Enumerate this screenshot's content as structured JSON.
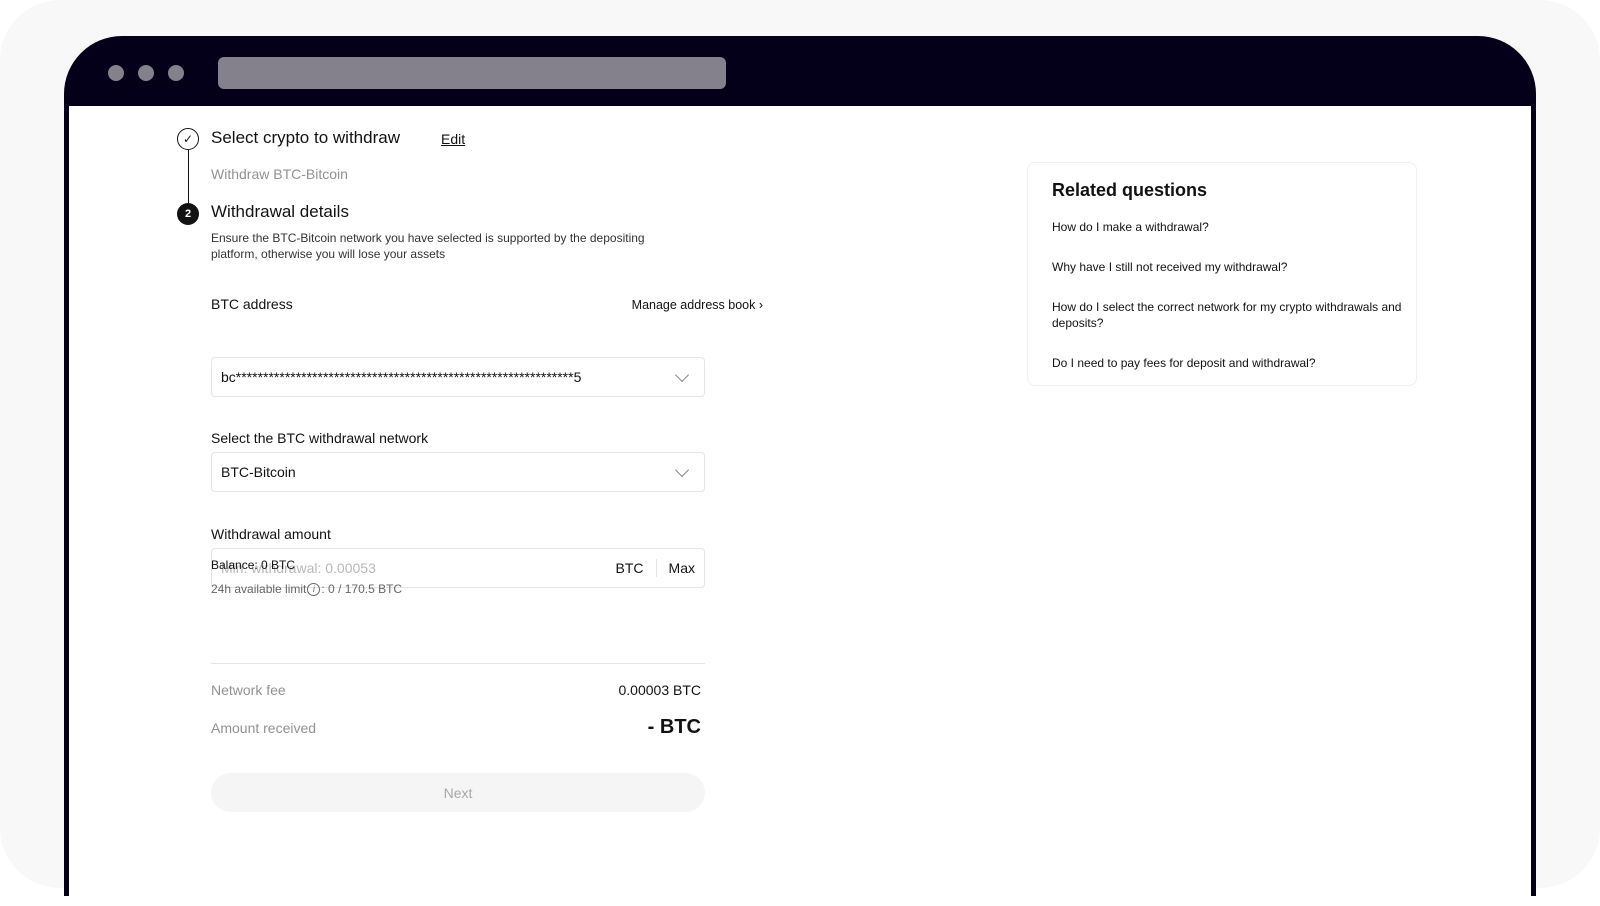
{
  "browser": {
    "window_controls": [
      "dot",
      "dot",
      "dot"
    ],
    "url_bar": ""
  },
  "stepper": {
    "step1": {
      "icon": "check-icon",
      "title": "Select crypto to withdraw",
      "edit_label": "Edit",
      "summary": "Withdraw BTC-Bitcoin"
    },
    "step2": {
      "number": "2",
      "title": "Withdrawal details",
      "notice": "Ensure the BTC-Bitcoin network you have selected is supported by the depositing platform, otherwise you will lose your assets"
    }
  },
  "address": {
    "label": "BTC address",
    "manage_link": "Manage address book ›",
    "value": "bc**************************************************************5"
  },
  "network": {
    "label": "Select the BTC withdrawal network",
    "selected": "BTC-Bitcoin"
  },
  "amount": {
    "label": "Withdrawal amount",
    "placeholder": "Min. withdrawal: 0.00053",
    "value": "",
    "unit": "BTC",
    "max_label": "Max",
    "balance": "Balance: 0 BTC",
    "limit_label": "24h available limit",
    "limit_value": ": 0 / 170.5 BTC"
  },
  "summary": {
    "fee_label": "Network fee",
    "fee_value": "0.00003 BTC",
    "received_label": "Amount received",
    "received_value": "- BTC"
  },
  "next_button": {
    "label": "Next",
    "disabled": true
  },
  "related": {
    "title": "Related questions",
    "questions": [
      "How do I make a withdrawal?",
      "Why have I still not received my withdrawal?",
      "How do I select the correct network for my crypto withdrawals and deposits?",
      "Do I need to pay fees for deposit and withdrawal?"
    ]
  },
  "colors": {
    "frame": "#05001a",
    "text_primary": "#121212",
    "text_muted": "#929292",
    "border": "#e5e5e5",
    "button_disabled_bg": "#f5f5f5"
  }
}
